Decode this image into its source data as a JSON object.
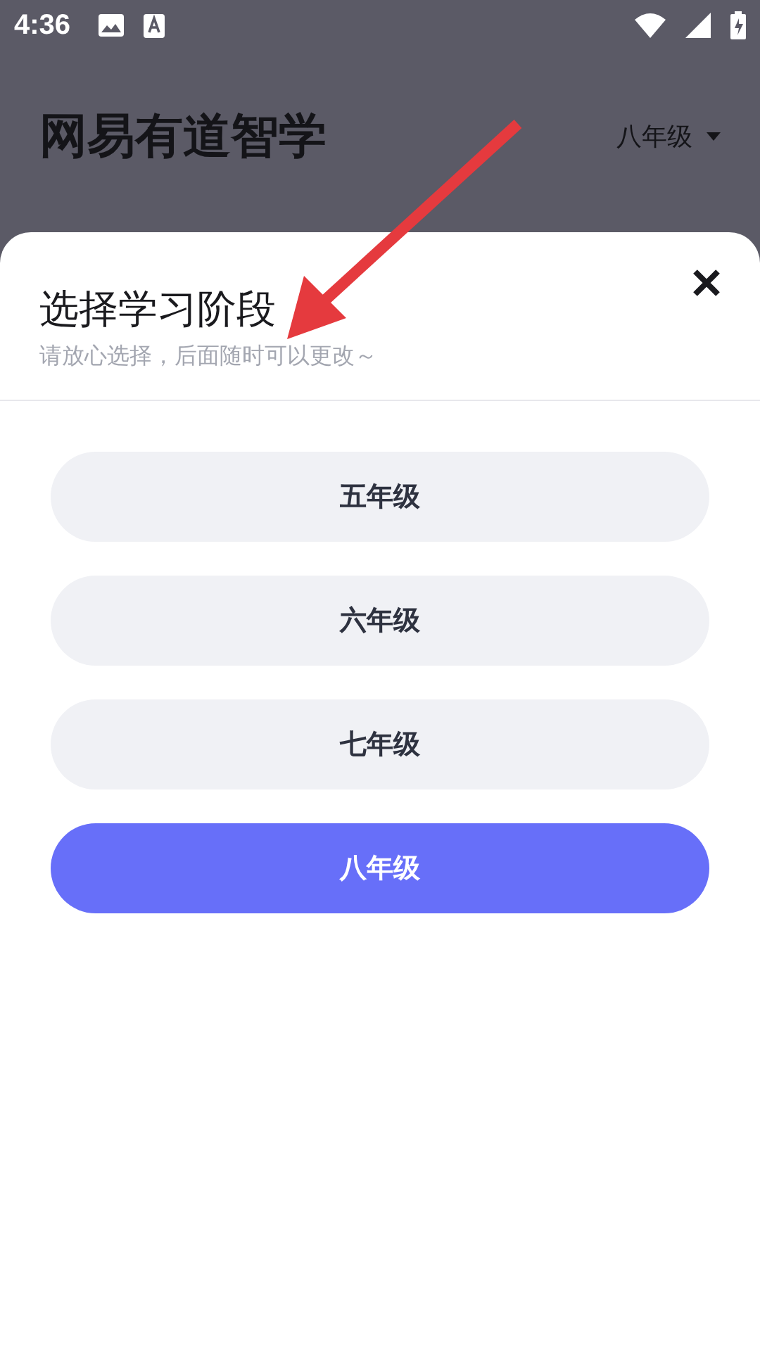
{
  "status_bar": {
    "time": "4:36"
  },
  "header": {
    "title": "网易有道智学",
    "grade": "八年级"
  },
  "sheet": {
    "title": "选择学习阶段",
    "subtitle": "请放心选择，后面随时可以更改～",
    "options": [
      {
        "label": "五年级",
        "selected": false
      },
      {
        "label": "六年级",
        "selected": false
      },
      {
        "label": "七年级",
        "selected": false
      },
      {
        "label": "八年级",
        "selected": true
      }
    ]
  }
}
